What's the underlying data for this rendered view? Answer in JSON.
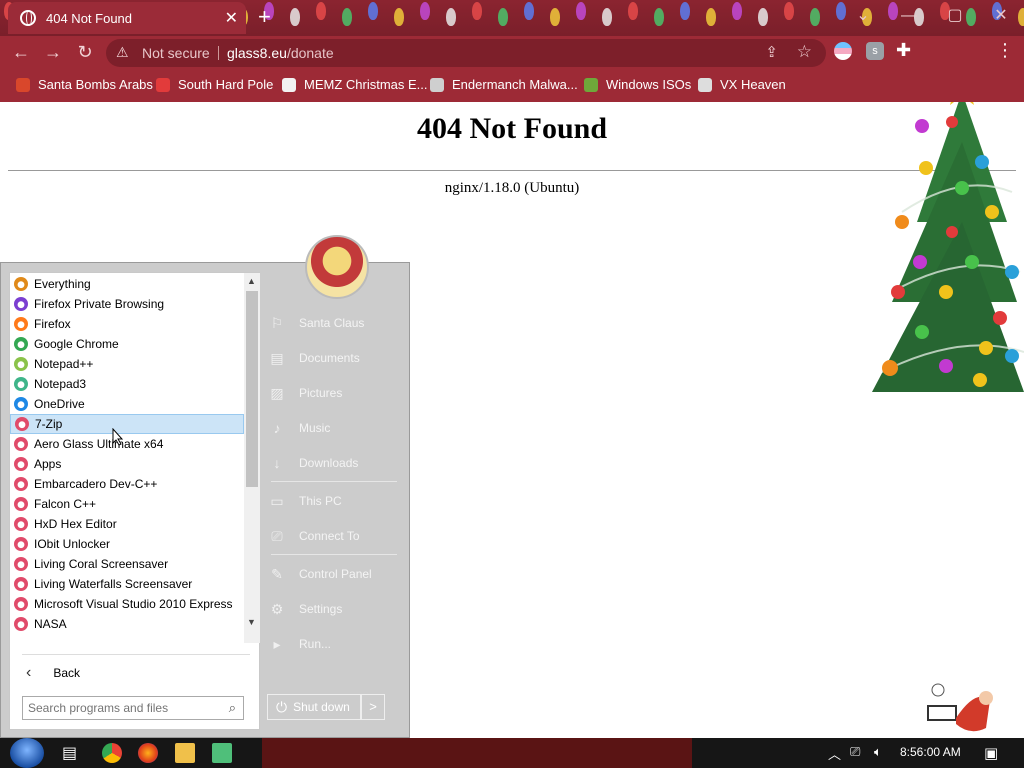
{
  "browser": {
    "tab_title": "404 Not Found",
    "security_label": "Not secure",
    "url_host": "glass8.eu",
    "url_path": "/donate",
    "new_tab_symbol": "+"
  },
  "bookmarks": [
    {
      "label": "Santa Bombs Arabs",
      "icon": "flame-icon",
      "color": "#d9472b"
    },
    {
      "label": "South Hard Pole",
      "icon": "snowflake-icon",
      "color": "#e23b3b"
    },
    {
      "label": "MEMZ Christmas E...",
      "icon": "memz-icon",
      "color": "#f2f2f2"
    },
    {
      "label": "Endermanch Malwa...",
      "icon": "skull-icon",
      "color": "#cfcfcf"
    },
    {
      "label": "Windows ISOs",
      "icon": "tree-icon",
      "color": "#6fa83a"
    },
    {
      "label": "VX Heaven",
      "icon": "virus-icon",
      "color": "#dddddd"
    }
  ],
  "page": {
    "heading": "404 Not Found",
    "server": "nginx/1.18.0 (Ubuntu)"
  },
  "start_menu": {
    "programs": [
      {
        "label": "Everything",
        "icon_color": "#e08a1a"
      },
      {
        "label": "Firefox Private Browsing",
        "icon_color": "#7b3fd1"
      },
      {
        "label": "Firefox",
        "icon_color": "#ff7a1a"
      },
      {
        "label": "Google Chrome",
        "icon_color": "#34a853"
      },
      {
        "label": "Notepad++",
        "icon_color": "#8bc34a"
      },
      {
        "label": "Notepad3",
        "icon_color": "#3fb58a"
      },
      {
        "label": "OneDrive",
        "icon_color": "#1e88e5"
      },
      {
        "label": "7-Zip",
        "icon_color": "#e04b6a",
        "selected": true
      },
      {
        "label": "Aero Glass Ultimate x64",
        "icon_color": "#e04b6a"
      },
      {
        "label": "Apps",
        "icon_color": "#e04b6a"
      },
      {
        "label": "Embarcadero Dev-C++",
        "icon_color": "#e04b6a"
      },
      {
        "label": "Falcon C++",
        "icon_color": "#e04b6a"
      },
      {
        "label": "HxD Hex Editor",
        "icon_color": "#e04b6a"
      },
      {
        "label": "IObit Unlocker",
        "icon_color": "#e04b6a"
      },
      {
        "label": "Living Coral Screensaver",
        "icon_color": "#e04b6a"
      },
      {
        "label": "Living Waterfalls Screensaver",
        "icon_color": "#e04b6a"
      },
      {
        "label": "Microsoft Visual Studio 2010 Express",
        "icon_color": "#e04b6a"
      },
      {
        "label": "NASA",
        "icon_color": "#e04b6a"
      }
    ],
    "back_label": "Back",
    "search_placeholder": "Search programs and files",
    "right_links": [
      {
        "label": "Santa Claus",
        "icon": "user-icon",
        "glyph": "⚐"
      },
      {
        "label": "Documents",
        "icon": "documents-icon",
        "glyph": "▤"
      },
      {
        "label": "Pictures",
        "icon": "pictures-icon",
        "glyph": "▨"
      },
      {
        "label": "Music",
        "icon": "music-icon",
        "glyph": "♪"
      },
      {
        "label": "Downloads",
        "icon": "downloads-icon",
        "glyph": "↓"
      },
      {
        "label": "This PC",
        "icon": "computer-icon",
        "glyph": "▭"
      },
      {
        "label": "Connect To",
        "icon": "network-icon",
        "glyph": "⎚"
      },
      {
        "label": "Control Panel",
        "icon": "wrench-icon",
        "glyph": "✎"
      },
      {
        "label": "Settings",
        "icon": "gear-icon",
        "glyph": "⚙"
      },
      {
        "label": "Run...",
        "icon": "run-icon",
        "glyph": "▸"
      }
    ],
    "shutdown_label": "Shut down",
    "shutdown_arrow": ">"
  },
  "taskbar": {
    "clock": "8:56:00 AM"
  }
}
